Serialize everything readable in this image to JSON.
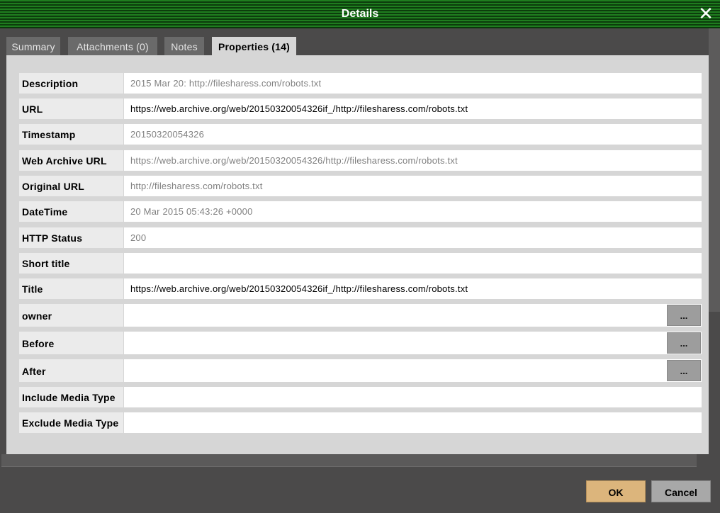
{
  "window": {
    "title": "Details",
    "close_glyph": "✕"
  },
  "tabs": [
    {
      "label": "Summary"
    },
    {
      "label": "Attachments (0)"
    },
    {
      "label": "Notes"
    },
    {
      "label": "Properties (14)"
    }
  ],
  "active_tab": "Properties (14)",
  "properties": [
    {
      "label": "Description",
      "value": "2015 Mar 20: http://filesharess.com/robots.txt"
    },
    {
      "label": "URL",
      "value": "https://web.archive.org/web/20150320054326if_/http://filesharess.com/robots.txt"
    },
    {
      "label": "Timestamp",
      "value": "20150320054326"
    },
    {
      "label": "Web Archive URL",
      "value": "https://web.archive.org/web/20150320054326/http://filesharess.com/robots.txt"
    },
    {
      "label": "Original URL",
      "value": "http://filesharess.com/robots.txt"
    },
    {
      "label": "DateTime",
      "value": "20 Mar 2015 05:43:26 +0000"
    },
    {
      "label": "HTTP Status",
      "value": "200"
    },
    {
      "label": "Short title",
      "value": ""
    },
    {
      "label": "Title",
      "value": "https://web.archive.org/web/20150320054326if_/http://filesharess.com/robots.txt"
    },
    {
      "label": "owner",
      "value": "",
      "button": "..."
    },
    {
      "label": "Before",
      "value": "",
      "button": "..."
    },
    {
      "label": "After",
      "value": "",
      "button": "..."
    },
    {
      "label": "Include Media Type",
      "value": ""
    },
    {
      "label": "Exclude Media Type",
      "value": ""
    }
  ],
  "footer": {
    "ok_label": "OK",
    "cancel_label": "Cancel"
  },
  "colors": {
    "titlebar_green": "#1f7d1f",
    "panel_bg": "#d6d6d6",
    "ok_button": "#dcb57c",
    "cancel_button": "#a8a8a8"
  },
  "icons": {
    "close": "close-icon"
  }
}
